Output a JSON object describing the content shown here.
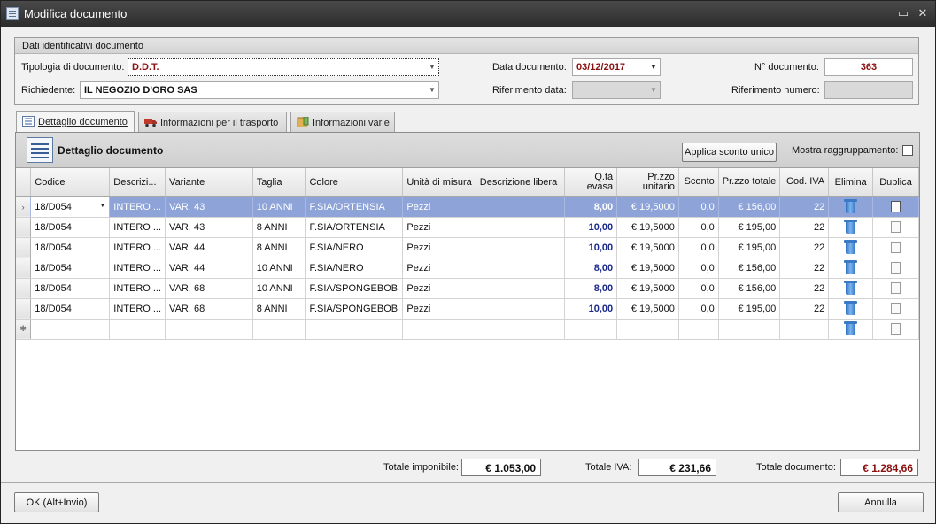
{
  "window": {
    "title": "Modifica documento",
    "minimize_glyph": "▭",
    "close_glyph": "✕"
  },
  "header": {
    "group_title": "Dati identificativi documento",
    "tipologia_label": "Tipologia di documento:",
    "tipologia_value": "D.D.T.",
    "richiedente_label": "Richiedente:",
    "richiedente_value": "IL NEGOZIO D'ORO SAS",
    "data_label": "Data documento:",
    "data_value": "03/12/2017",
    "rif_data_label": "Riferimento data:",
    "rif_data_value": "",
    "numero_label": "N° documento:",
    "numero_value": "363",
    "rif_numero_label": "Riferimento numero:",
    "rif_numero_value": ""
  },
  "tabs": [
    {
      "label": "Dettaglio documento",
      "icon": "list-icon"
    },
    {
      "label": "Informazioni per il trasporto",
      "icon": "truck-icon"
    },
    {
      "label": "Informazioni varie",
      "icon": "info-box-icon"
    }
  ],
  "panel": {
    "title": "Dettaglio documento",
    "discount_button": "Applica sconto unico",
    "grouping_label": "Mostra raggruppamento:",
    "grouping_checked": false
  },
  "grid": {
    "columns": [
      {
        "key": "codice",
        "label": "Codice"
      },
      {
        "key": "descrizione",
        "label": "Descrizi..."
      },
      {
        "key": "variante",
        "label": "Variante"
      },
      {
        "key": "taglia",
        "label": "Taglia"
      },
      {
        "key": "colore",
        "label": "Colore"
      },
      {
        "key": "unita",
        "label": "Unità di misura"
      },
      {
        "key": "libera",
        "label": "Descrizione libera"
      },
      {
        "key": "qta",
        "label": "Q.tà evasa"
      },
      {
        "key": "prezzo",
        "label": "Pr.zzo unitario"
      },
      {
        "key": "sconto",
        "label": "Sconto"
      },
      {
        "key": "totale",
        "label": "Pr.zzo totale"
      },
      {
        "key": "iva",
        "label": "Cod. IVA"
      },
      {
        "key": "elimina",
        "label": "Elimina"
      },
      {
        "key": "duplica",
        "label": "Duplica"
      }
    ],
    "selected_indicator": "›",
    "new_row_indicator": "✱",
    "rows": [
      {
        "codice": "18/D054",
        "descrizione": "INTERO ...",
        "variante": "VAR. 43",
        "taglia": "10 ANNI",
        "colore": "F.SIA/ORTENSIA",
        "unita": "Pezzi",
        "libera": "",
        "qta": "8,00",
        "prezzo": "€ 19,5000",
        "sconto": "0,0",
        "totale": "€ 156,00",
        "iva": "22"
      },
      {
        "codice": "18/D054",
        "descrizione": "INTERO ...",
        "variante": "VAR. 43",
        "taglia": "8 ANNI",
        "colore": "F.SIA/ORTENSIA",
        "unita": "Pezzi",
        "libera": "",
        "qta": "10,00",
        "prezzo": "€ 19,5000",
        "sconto": "0,0",
        "totale": "€ 195,00",
        "iva": "22"
      },
      {
        "codice": "18/D054",
        "descrizione": "INTERO ...",
        "variante": "VAR. 44",
        "taglia": "8 ANNI",
        "colore": "F.SIA/NERO",
        "unita": "Pezzi",
        "libera": "",
        "qta": "10,00",
        "prezzo": "€ 19,5000",
        "sconto": "0,0",
        "totale": "€ 195,00",
        "iva": "22"
      },
      {
        "codice": "18/D054",
        "descrizione": "INTERO ...",
        "variante": "VAR. 44",
        "taglia": "10 ANNI",
        "colore": "F.SIA/NERO",
        "unita": "Pezzi",
        "libera": "",
        "qta": "8,00",
        "prezzo": "€ 19,5000",
        "sconto": "0,0",
        "totale": "€ 156,00",
        "iva": "22"
      },
      {
        "codice": "18/D054",
        "descrizione": "INTERO ...",
        "variante": "VAR. 68",
        "taglia": "10 ANNI",
        "colore": "F.SIA/SPONGEBOB",
        "unita": "Pezzi",
        "libera": "",
        "qta": "8,00",
        "prezzo": "€ 19,5000",
        "sconto": "0,0",
        "totale": "€ 156,00",
        "iva": "22"
      },
      {
        "codice": "18/D054",
        "descrizione": "INTERO ...",
        "variante": "VAR. 68",
        "taglia": "8 ANNI",
        "colore": "F.SIA/SPONGEBOB",
        "unita": "Pezzi",
        "libera": "",
        "qta": "10,00",
        "prezzo": "€ 19,5000",
        "sconto": "0,0",
        "totale": "€ 195,00",
        "iva": "22"
      }
    ]
  },
  "totals": {
    "imponibile_label": "Totale imponibile:",
    "imponibile_value": "€ 1.053,00",
    "iva_label": "Totale IVA:",
    "iva_value": "€ 231,66",
    "documento_label": "Totale documento:",
    "documento_value": "€ 1.284,66"
  },
  "footer": {
    "ok_label": "OK (Alt+Invio)",
    "cancel_label": "Annulla"
  },
  "colors": {
    "selected_row": "#8ea3d8",
    "quantity_text": "#1b2a8a",
    "accent_red": "#8b1010"
  }
}
